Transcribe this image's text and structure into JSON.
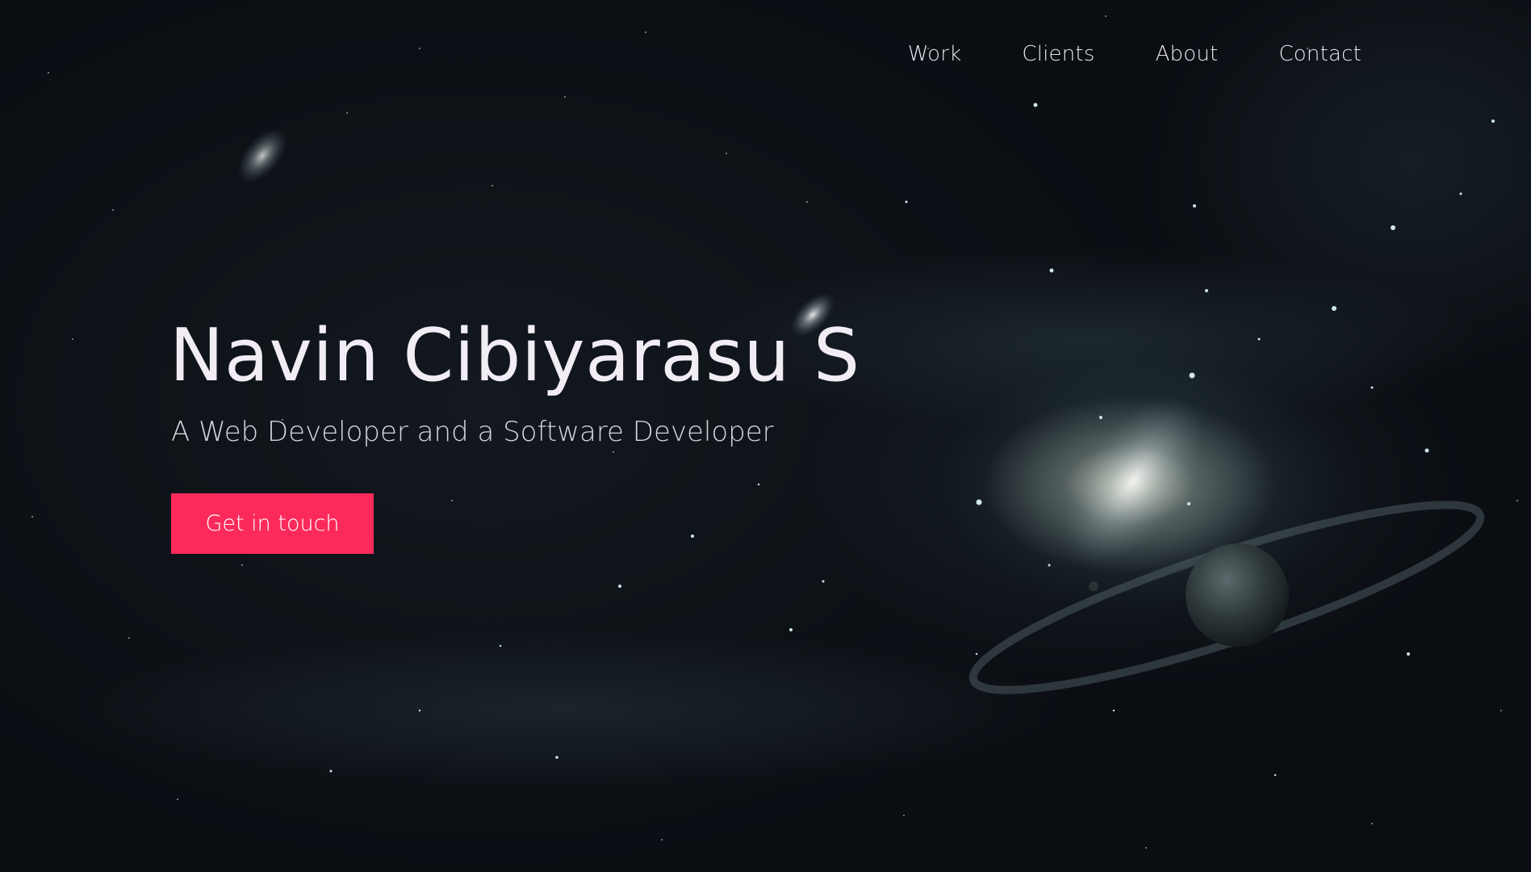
{
  "nav": {
    "items": [
      {
        "label": "Work"
      },
      {
        "label": "Clients"
      },
      {
        "label": "About"
      },
      {
        "label": "Contact"
      }
    ]
  },
  "hero": {
    "title": "Navin Cibiyarasu S",
    "subtitle": "A Web Developer and a Software Developer",
    "cta_label": "Get in touch",
    "background": "space-galaxy-illustration"
  },
  "colors": {
    "accent": "#fb2a5b",
    "text": "#f2edf5",
    "background": "#0b0f14"
  }
}
